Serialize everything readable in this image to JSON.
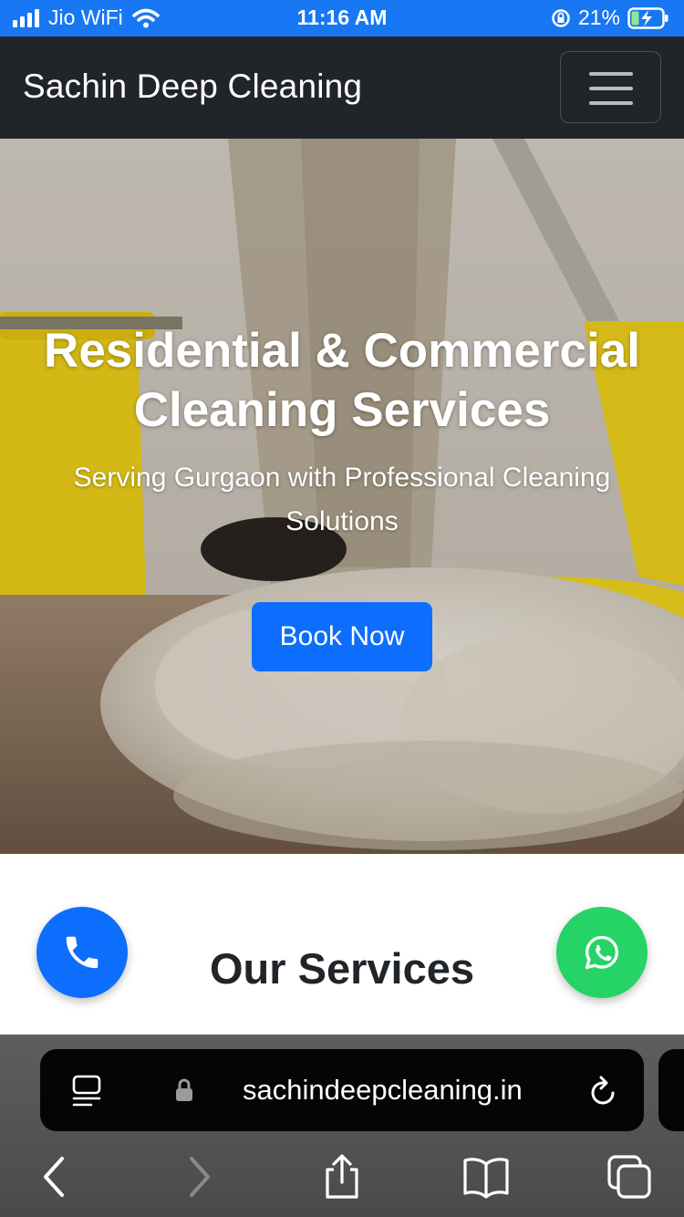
{
  "status_bar": {
    "carrier": "Jio WiFi",
    "time": "11:16 AM",
    "battery": "21%"
  },
  "navbar": {
    "brand": "Sachin Deep Cleaning",
    "menu_icon": "hamburger-menu-icon"
  },
  "hero": {
    "title": "Residential & Commercial Cleaning Services",
    "subtitle": "Serving Gurgaon with Professional Cleaning Solutions",
    "cta_label": "Book Now"
  },
  "services": {
    "title": "Our Services"
  },
  "floating_buttons": {
    "phone_icon": "phone-icon",
    "whatsapp_icon": "whatsapp-icon"
  },
  "browser": {
    "url": "sachindeepcleaning.in",
    "icons": [
      "page-menu-icon",
      "lock-icon",
      "reload-icon",
      "back-icon",
      "forward-icon",
      "share-icon",
      "bookmarks-icon",
      "tabs-icon"
    ]
  },
  "colors": {
    "status_bar": "#1877f2",
    "navbar": "#212529",
    "primary": "#0d6efd",
    "whatsapp": "#25d366"
  }
}
